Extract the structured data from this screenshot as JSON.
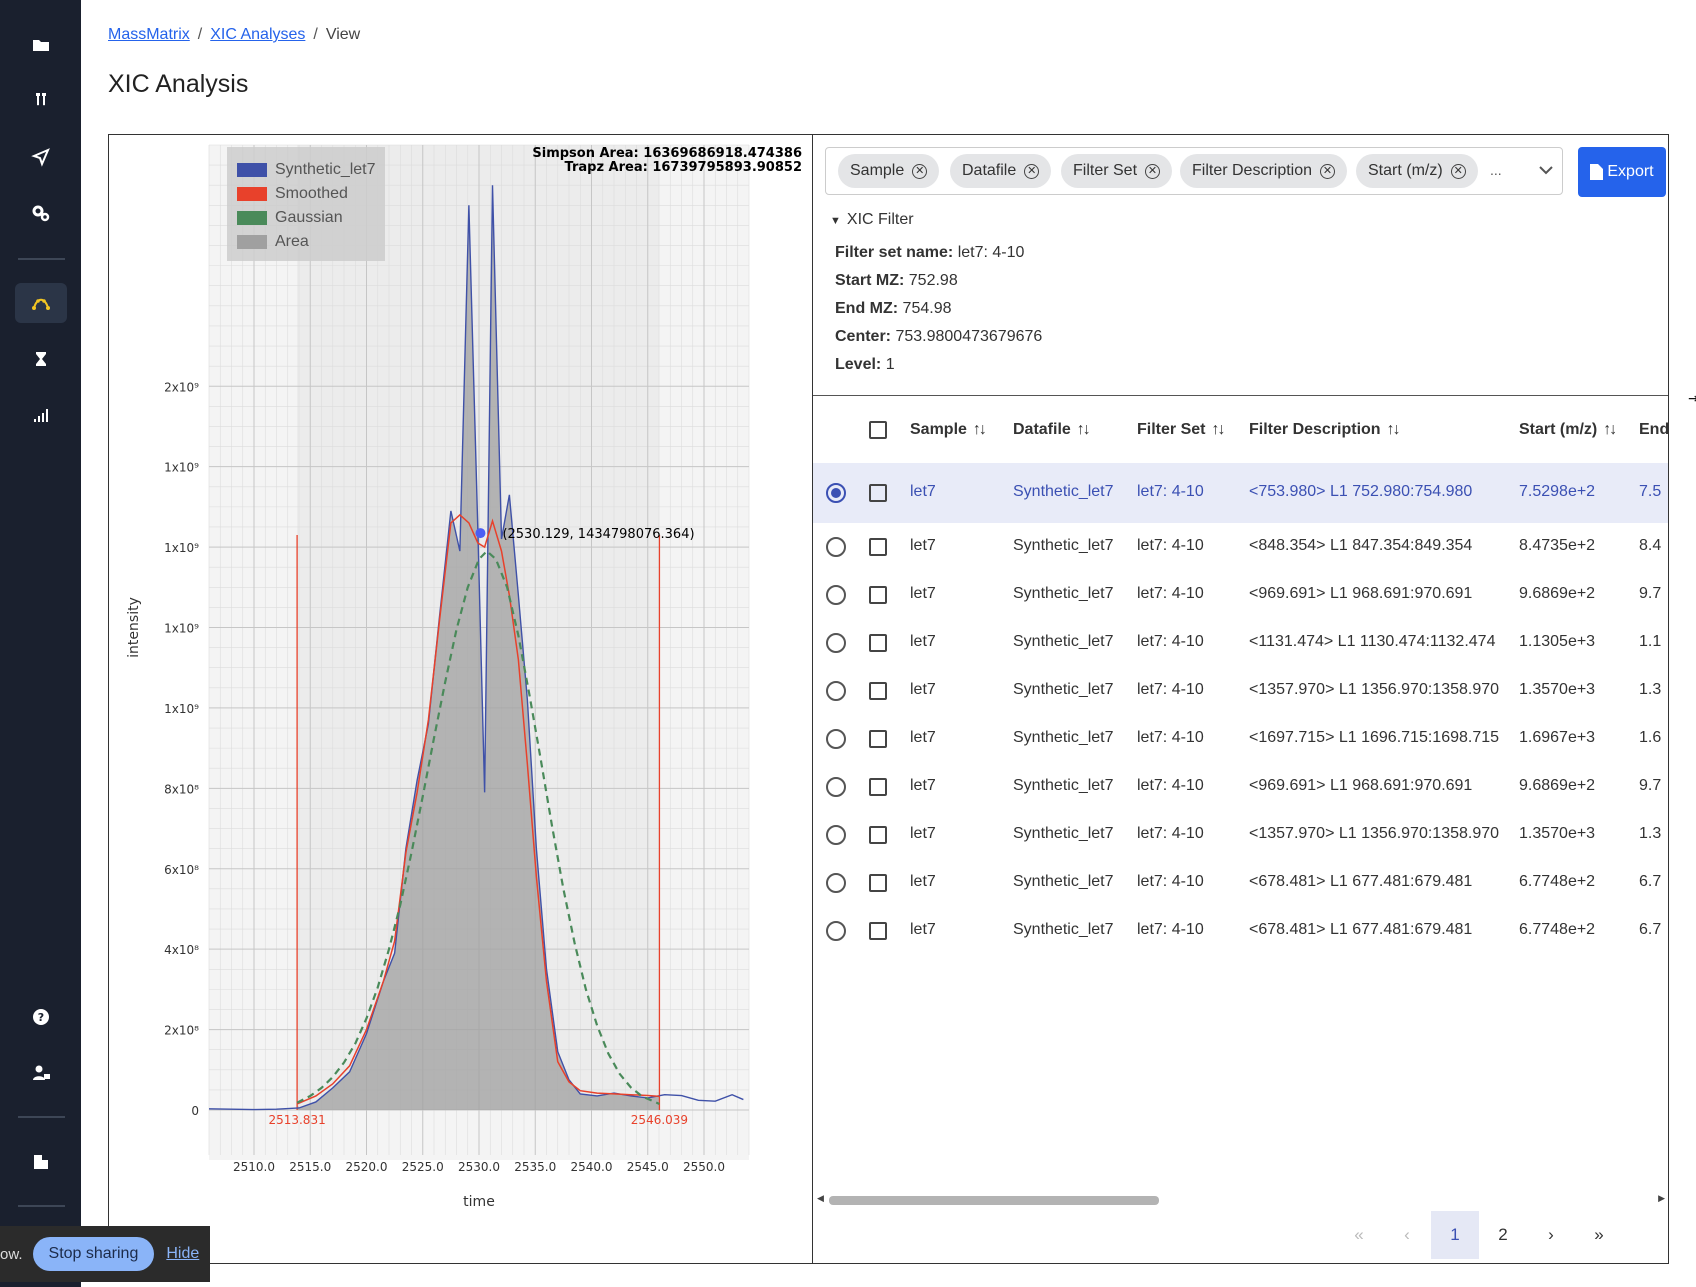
{
  "sidebar": {
    "items": [
      {
        "icon": "folder-icon"
      },
      {
        "icon": "test-tubes-icon"
      },
      {
        "icon": "send-icon"
      },
      {
        "icon": "gears-icon"
      },
      {
        "icon": "curve-icon",
        "active": true
      },
      {
        "icon": "hourglass-icon"
      },
      {
        "icon": "signal-bars-icon"
      },
      {
        "icon": "help-icon"
      },
      {
        "icon": "user-lock-icon"
      },
      {
        "icon": "building-icon"
      }
    ]
  },
  "breadcrumb": {
    "root": "MassMatrix",
    "section": "XIC Analyses",
    "current": "View",
    "sep": "/"
  },
  "page": {
    "title": "XIC Analysis"
  },
  "filters": {
    "chips": [
      "Sample",
      "Datafile",
      "Filter Set",
      "Filter Description",
      "Start (m/z)"
    ],
    "more": "...",
    "export_label": "Export"
  },
  "xic_filter": {
    "toggle_label": "XIC Filter",
    "filter_set_name_label": "Filter set name:",
    "filter_set_name": "let7: 4-10",
    "start_mz_label": "Start MZ:",
    "start_mz": "752.98",
    "end_mz_label": "End MZ:",
    "end_mz": "754.98",
    "center_label": "Center:",
    "center": "753.9800473679676",
    "level_label": "Level:",
    "level": "1"
  },
  "table": {
    "columns": [
      "Sample",
      "Datafile",
      "Filter Set",
      "Filter Description",
      "Start (m/z)",
      "End"
    ],
    "rows": [
      {
        "sample": "let7",
        "datafile": "Synthetic_let7",
        "filter_set": "let7: 4-10",
        "desc": "<753.980> L1 752.980:754.980",
        "start": "7.5298e+2",
        "end": "7.5",
        "selected": true
      },
      {
        "sample": "let7",
        "datafile": "Synthetic_let7",
        "filter_set": "let7: 4-10",
        "desc": "<848.354> L1 847.354:849.354",
        "start": "8.4735e+2",
        "end": "8.4"
      },
      {
        "sample": "let7",
        "datafile": "Synthetic_let7",
        "filter_set": "let7: 4-10",
        "desc": "<969.691> L1 968.691:970.691",
        "start": "9.6869e+2",
        "end": "9.7"
      },
      {
        "sample": "let7",
        "datafile": "Synthetic_let7",
        "filter_set": "let7: 4-10",
        "desc": "<1131.474> L1 1130.474:1132.474",
        "start": "1.1305e+3",
        "end": "1.1"
      },
      {
        "sample": "let7",
        "datafile": "Synthetic_let7",
        "filter_set": "let7: 4-10",
        "desc": "<1357.970> L1 1356.970:1358.970",
        "start": "1.3570e+3",
        "end": "1.3"
      },
      {
        "sample": "let7",
        "datafile": "Synthetic_let7",
        "filter_set": "let7: 4-10",
        "desc": "<1697.715> L1 1696.715:1698.715",
        "start": "1.6967e+3",
        "end": "1.6"
      },
      {
        "sample": "let7",
        "datafile": "Synthetic_let7",
        "filter_set": "let7: 4-10",
        "desc": "<969.691> L1 968.691:970.691",
        "start": "9.6869e+2",
        "end": "9.7"
      },
      {
        "sample": "let7",
        "datafile": "Synthetic_let7",
        "filter_set": "let7: 4-10",
        "desc": "<1357.970> L1 1356.970:1358.970",
        "start": "1.3570e+3",
        "end": "1.3"
      },
      {
        "sample": "let7",
        "datafile": "Synthetic_let7",
        "filter_set": "let7: 4-10",
        "desc": "<678.481> L1 677.481:679.481",
        "start": "6.7748e+2",
        "end": "6.7"
      },
      {
        "sample": "let7",
        "datafile": "Synthetic_let7",
        "filter_set": "let7: 4-10",
        "desc": "<678.481> L1 677.481:679.481",
        "start": "6.7748e+2",
        "end": "6.7"
      }
    ]
  },
  "pagination": {
    "first": "«",
    "prev": "‹",
    "pages": [
      "1",
      "2"
    ],
    "current": "1",
    "next": "›",
    "last": "»"
  },
  "sharing": {
    "text": "ow.",
    "stop_label": "Stop sharing",
    "hide_label": "Hide"
  },
  "chart_data": {
    "type": "line",
    "xlabel": "time",
    "ylabel": "intensity",
    "xlim": [
      2506,
      2554
    ],
    "ylim": [
      0,
      2400000000
    ],
    "x_ticks": [
      "2510.0",
      "2515.0",
      "2520.0",
      "2525.0",
      "2530.0",
      "2535.0",
      "2540.0",
      "2545.0",
      "2550.0"
    ],
    "x_tick_values": [
      2510,
      2515,
      2520,
      2525,
      2530,
      2535,
      2540,
      2545,
      2550
    ],
    "y_ticks": [
      "0",
      "2x10⁸",
      "4x10⁸",
      "6x10⁸",
      "8x10⁸",
      "1x10⁹",
      "1x10⁹",
      "1x10⁹",
      "1x10⁹",
      "2x10⁹"
    ],
    "y_tick_values": [
      0,
      200000000,
      400000000,
      600000000,
      800000000,
      1000000000,
      1200000000,
      1400000000,
      1600000000,
      1800000000
    ],
    "legend": [
      "Synthetic_let7",
      "Smoothed",
      "Gaussian",
      "Area"
    ],
    "colors": {
      "raw": "#3f51a8",
      "smoothed": "#e8412b",
      "gaussian": "#4a8a5a",
      "area": "#a0a0a0",
      "bounds": "#e8412b"
    },
    "simpson_label": "Simpson Area: 16369686918.474386",
    "trapz_label": "Trapz Area: 16739795893.90852",
    "hover_label": "(2530.129, 1434798076.364)",
    "hover_point": [
      2530.129,
      1434798076.364
    ],
    "bounds": [
      2513.831,
      2546.039
    ],
    "bound_labels": [
      "2513.831",
      "2546.039"
    ],
    "bound_line_top": 1430000000,
    "series": [
      {
        "name": "Synthetic_let7",
        "x": [
          2506,
          2508,
          2510,
          2512,
          2514,
          2515.5,
          2517,
          2518.5,
          2520,
          2521.5,
          2522.5,
          2523.5,
          2524.5,
          2525.5,
          2526.5,
          2527.5,
          2528.3,
          2529.1,
          2529.9,
          2530.5,
          2531.2,
          2532,
          2532.7,
          2533.5,
          2534.3,
          2535.1,
          2536,
          2537,
          2538,
          2539,
          2540.5,
          2542,
          2543.5,
          2545,
          2546.5,
          2548,
          2549.5,
          2551,
          2552.5,
          2553.5
        ],
        "y": [
          3000000,
          2000000,
          1000000,
          2000000,
          5000000,
          20000000,
          55000000,
          95000000,
          190000000,
          320000000,
          390000000,
          650000000,
          820000000,
          960000000,
          1230000000,
          1490000000,
          1390000000,
          2250000000,
          1440000000,
          790000000,
          2300000000,
          1420000000,
          1530000000,
          1280000000,
          1020000000,
          650000000,
          350000000,
          145000000,
          75000000,
          40000000,
          35000000,
          42000000,
          35000000,
          30000000,
          38000000,
          36000000,
          24000000,
          22000000,
          38000000,
          26000000
        ]
      },
      {
        "name": "Smoothed",
        "x": [
          2513.831,
          2515.5,
          2517,
          2518.5,
          2520,
          2521.5,
          2522.5,
          2523.5,
          2524.5,
          2525.5,
          2526.5,
          2527.5,
          2528.3,
          2529.1,
          2529.9,
          2530.5,
          2531.2,
          2532,
          2532.7,
          2533.5,
          2534.3,
          2535.1,
          2536,
          2537,
          2538,
          2539,
          2540.5,
          2542,
          2543.5,
          2545,
          2546.039
        ],
        "y": [
          15000000,
          35000000,
          65000000,
          110000000,
          200000000,
          320000000,
          420000000,
          640000000,
          790000000,
          970000000,
          1220000000,
          1460000000,
          1480000000,
          1460000000,
          1410000000,
          1400000000,
          1465000000,
          1390000000,
          1280000000,
          1120000000,
          860000000,
          580000000,
          320000000,
          120000000,
          70000000,
          48000000,
          42000000,
          40000000,
          38000000,
          36000000,
          34000000
        ]
      },
      {
        "name": "Gaussian",
        "x": [
          2513.831,
          2515,
          2516,
          2517,
          2518,
          2519,
          2520,
          2521,
          2522,
          2523,
          2524,
          2525,
          2526,
          2527,
          2528,
          2529,
          2530,
          2530.7,
          2531.5,
          2532.5,
          2533.5,
          2534.5,
          2535.5,
          2536.5,
          2537.5,
          2538.5,
          2539.5,
          2540.5,
          2541.5,
          2542.5,
          2543.5,
          2544.5,
          2546.039
        ],
        "y": [
          18000000,
          35000000,
          55000000,
          82000000,
          118000000,
          165000000,
          228000000,
          305000000,
          400000000,
          510000000,
          640000000,
          780000000,
          925000000,
          1065000000,
          1195000000,
          1300000000,
          1370000000,
          1390000000,
          1370000000,
          1300000000,
          1180000000,
          1030000000,
          870000000,
          705000000,
          550000000,
          415000000,
          300000000,
          210000000,
          140000000,
          90000000,
          56000000,
          34000000,
          15000000
        ]
      }
    ]
  }
}
